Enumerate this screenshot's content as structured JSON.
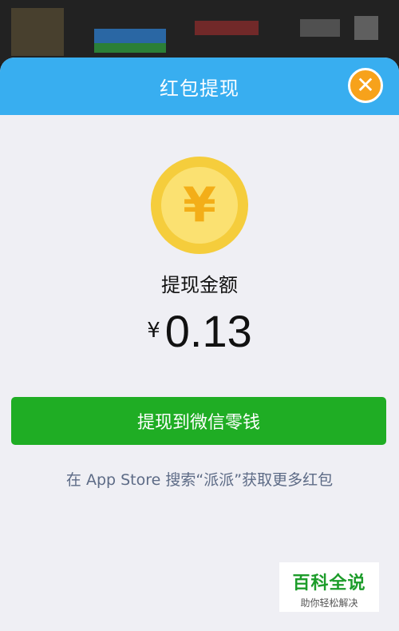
{
  "header": {
    "title": "红包提现",
    "close_icon": "close-icon"
  },
  "coin": {
    "symbol": "¥",
    "icon": "coin-icon"
  },
  "amount": {
    "label": "提现金额",
    "currency": "¥",
    "value": "0.13"
  },
  "actions": {
    "withdraw_label": "提现到微信零钱"
  },
  "hint": {
    "text": "在 App Store 搜索“派派”获取更多红包"
  },
  "watermark": {
    "title": "百科全说",
    "subtitle": "助你轻松解决"
  },
  "colors": {
    "header": "#38aef0",
    "close_button": "#f7a21b",
    "withdraw_button": "#1fad24",
    "coin_outer": "#f5cd3c",
    "coin_inner": "#fbe171"
  }
}
